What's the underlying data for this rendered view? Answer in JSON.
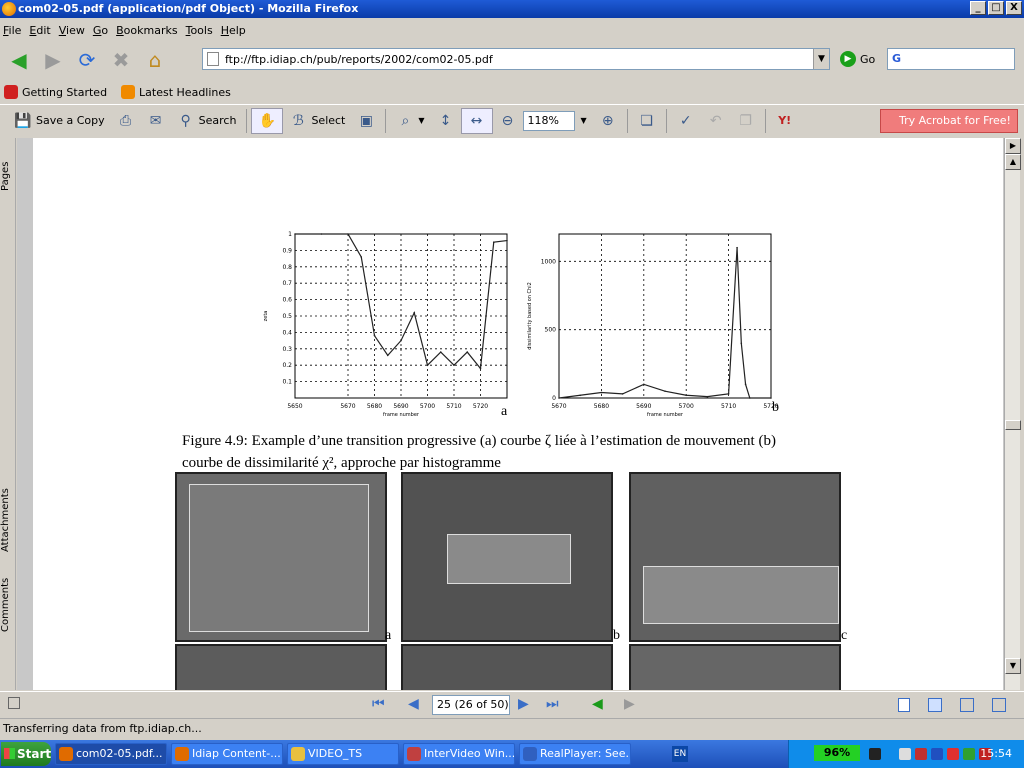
{
  "window": {
    "title": "com02-05.pdf (application/pdf Object) - Mozilla Firefox",
    "buttons": [
      "_",
      "□",
      "X"
    ]
  },
  "menu": [
    "File",
    "Edit",
    "View",
    "Go",
    "Bookmarks",
    "Tools",
    "Help"
  ],
  "nav": {
    "url": "ftp://ftp.idiap.ch/pub/reports/2002/com02-05.pdf",
    "go_label": "Go",
    "search_value": "G"
  },
  "bookmarks": [
    {
      "label": "Getting Started",
      "color": "#d02020"
    },
    {
      "label": "Latest Headlines",
      "color": "#f08a00"
    }
  ],
  "acrobat": {
    "save_copy": "Save a Copy",
    "search": "Search",
    "select": "Select",
    "zoom": "118%",
    "try": "Try Acrobat for Free!"
  },
  "sidebar": {
    "pages": "Pages",
    "attachments": "Attachments",
    "comments": "Comments"
  },
  "document": {
    "caption_line1": "Figure 4.9: Example d’une transition progressive (a) courbe ζ liée à l’estimation de mouvement (b)",
    "caption_line2": "courbe de dissimilarité χ², approche par histogramme",
    "chart_a_letter": "a",
    "chart_b_letter": "b",
    "frame_letters": [
      "a",
      "b",
      "c"
    ]
  },
  "chart_data": [
    {
      "type": "line",
      "xlabel": "frame number",
      "ylabel": "zeta",
      "x": [
        5650,
        5660,
        5670,
        5675,
        5680,
        5685,
        5690,
        5695,
        5700,
        5705,
        5710,
        5715,
        5720,
        5725,
        5730
      ],
      "series": [
        {
          "values": [
            1.0,
            1.0,
            1.0,
            0.86,
            0.38,
            0.26,
            0.35,
            0.52,
            0.2,
            0.28,
            0.2,
            0.28,
            0.18,
            0.95,
            0.96
          ]
        }
      ],
      "xlim": [
        5650,
        5730
      ],
      "ylim": [
        0.0,
        1.0
      ],
      "grid": true,
      "xticks": [
        "5650",
        "5670",
        "5680",
        "5690",
        "5700",
        "5710",
        "5720"
      ],
      "yticks": [
        "0.1",
        "0.2",
        "0.3",
        "0.4",
        "0.5",
        "0.6",
        "0.7",
        "0.8",
        "0.9",
        "1"
      ]
    },
    {
      "type": "line",
      "xlabel": "frame number",
      "ylabel": "dissimilarity based on Chi2",
      "x": [
        5670,
        5675,
        5680,
        5685,
        5690,
        5695,
        5700,
        5705,
        5710,
        5712,
        5713,
        5714,
        5715,
        5720
      ],
      "series": [
        {
          "values": [
            0,
            20,
            40,
            30,
            100,
            50,
            20,
            10,
            30,
            1100,
            400,
            100,
            0,
            0
          ]
        }
      ],
      "xlim": [
        5670,
        5720
      ],
      "ylim": [
        0,
        1200
      ],
      "grid": true,
      "xticks": [
        "5670",
        "5680",
        "5690",
        "5700",
        "5710",
        "5720"
      ],
      "yticks": [
        "0",
        "500",
        "1000"
      ]
    }
  ],
  "bottom": {
    "page_box": "25  (26 of 50)"
  },
  "status": "Transferring data from ftp.idiap.ch...",
  "taskbar": {
    "start": "Start",
    "tasks": [
      "com02-05.pdf...",
      "Idiap Content-...",
      "VIDEO_TS",
      "InterVideo Win...",
      "RealPlayer: See..."
    ],
    "lang": "EN",
    "battery": "96%",
    "clock": "15:54"
  }
}
